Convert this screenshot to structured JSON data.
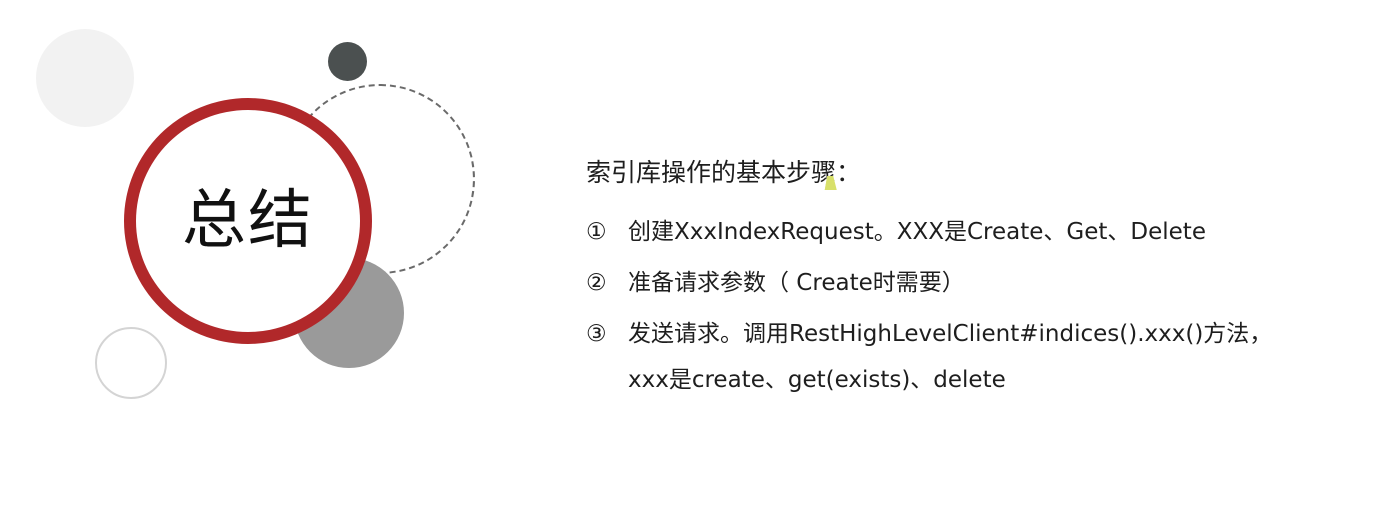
{
  "title": "总结",
  "summary": {
    "heading": "索引库操作的基本步骤：",
    "steps": [
      {
        "num": "①",
        "text": "创建XxxIndexRequest。XXX是Create、Get、Delete"
      },
      {
        "num": "②",
        "text": "准备请求参数（ Create时需要）"
      },
      {
        "num": "③",
        "text": "发送请求。调用RestHighLevelClient#indices().xxx()方法，xxx是create、get(exists)、delete"
      }
    ]
  },
  "colors": {
    "ring": "#b1282a",
    "dark_dot": "#4b5050",
    "mid_gray": "#9a9a9a"
  }
}
